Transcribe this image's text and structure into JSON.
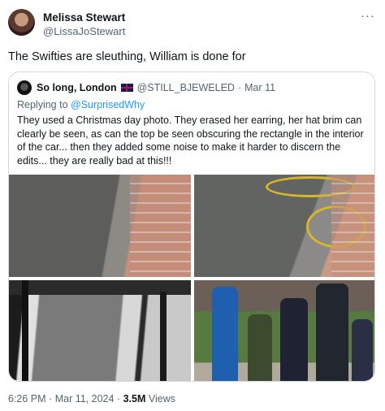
{
  "author": {
    "name": "Melissa Stewart",
    "handle": "@LissaJoStewart",
    "more_icon": "more-horizontal-icon"
  },
  "tweet": {
    "text": "The Swifties are sleuthing, William is done for"
  },
  "quoted": {
    "name": "So long, London",
    "flag_icon": "uk-flag-icon",
    "handle": "@STILL_BJEWELED",
    "separator": "·",
    "date": "Mar 11",
    "replying_prefix": "Replying to",
    "replying_to": "@SurprisedWhy",
    "text": "They used a Christmas day photo. They erased her earring, her hat brim can clearly be seen, as can the top be seen obscuring the rectangle in the interior of the car... then they added some noise to make it harder to discern the edits... they are really bad at this!!!"
  },
  "footer": {
    "time": "6:26 PM",
    "separator1": "·",
    "date": "Mar 11, 2024",
    "separator2": "·",
    "views_count": "3.5M",
    "views_label": "Views"
  },
  "colors": {
    "link": "#1d9bf0",
    "secondary_text": "#536471",
    "annotation_ring": "#d9b52a"
  }
}
